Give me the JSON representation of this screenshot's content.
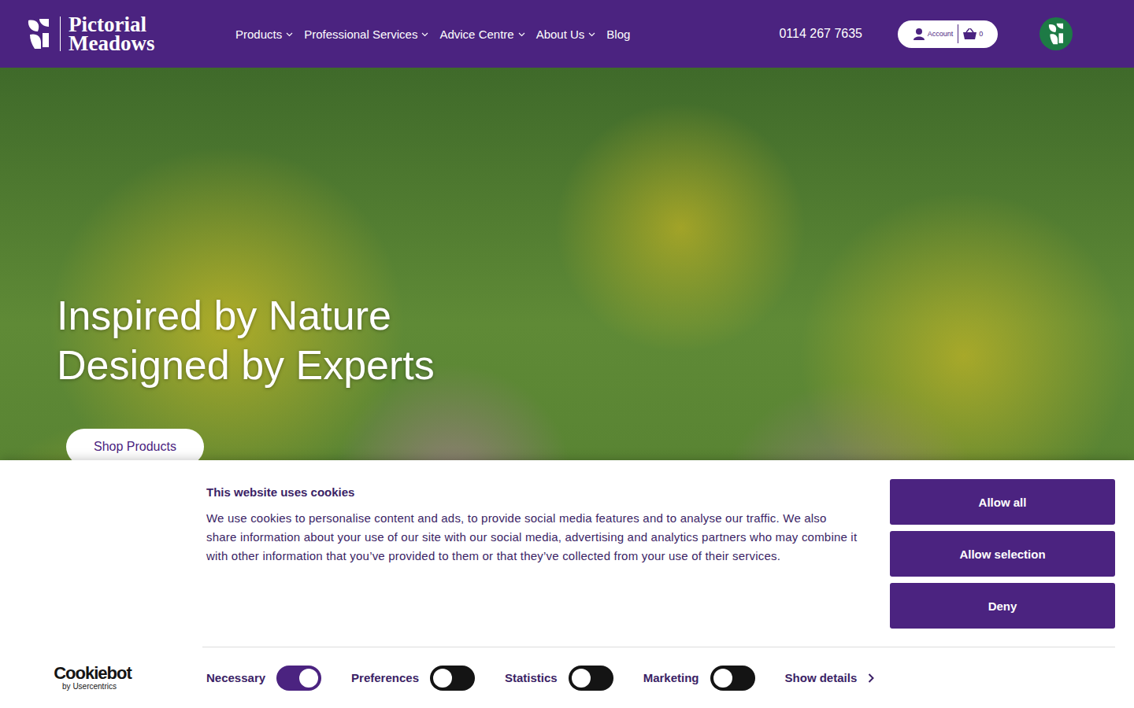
{
  "header": {
    "brand": {
      "line1": "Pictorial",
      "line2": "Meadows"
    },
    "nav": [
      {
        "label": "Products",
        "dropdown": true
      },
      {
        "label": "Professional Services",
        "dropdown": true
      },
      {
        "label": "Advice Centre",
        "dropdown": true
      },
      {
        "label": "About Us",
        "dropdown": true
      },
      {
        "label": "Blog",
        "dropdown": false
      }
    ],
    "phone": "0114 267 7635",
    "account": {
      "label": "Account"
    },
    "basket": {
      "count": "0"
    }
  },
  "hero": {
    "title_lines": [
      "Inspired by Nature",
      "Designed by Experts"
    ],
    "button": "Shop Products"
  },
  "cookie_banner": {
    "title": "This website uses cookies",
    "body": "We use cookies to personalise content and ads, to provide social media features and to analyse our traffic. We also share information about your use of our site with our social media, advertising and analytics partners who may combine it with other information that you’ve provided to them or that they’ve collected from your use of their services.",
    "buttons": [
      "Allow all",
      "Allow selection",
      "Deny"
    ],
    "toggles": [
      {
        "label": "Necessary",
        "on": true
      },
      {
        "label": "Preferences",
        "on": false
      },
      {
        "label": "Statistics",
        "on": false
      },
      {
        "label": "Marketing",
        "on": false
      }
    ],
    "details": "Show details",
    "provider": {
      "name": "Cookiebot",
      "sub": "by Usercentrics"
    }
  }
}
